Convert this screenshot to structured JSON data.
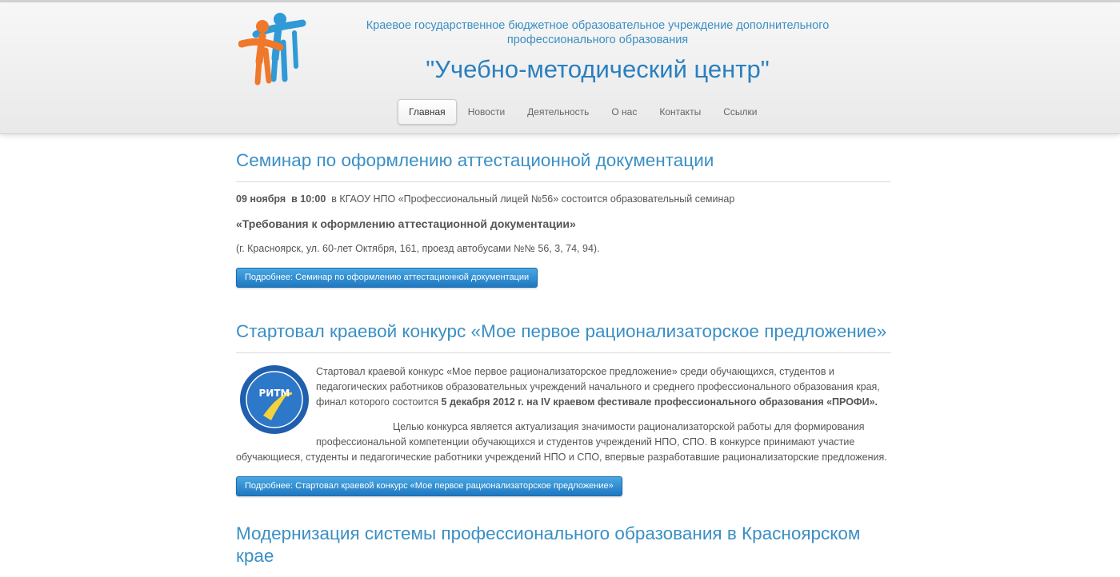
{
  "header": {
    "org_line1": "Краевое государственное бюджетное образовательное учреждение дополнительного",
    "org_line2": "профессионального образования",
    "site_title": "\"Учебно-методический центр\""
  },
  "nav": {
    "items": [
      {
        "label": "Главная",
        "active": true
      },
      {
        "label": "Новости"
      },
      {
        "label": "Деятельность"
      },
      {
        "label": "О нас"
      },
      {
        "label": "Контакты"
      },
      {
        "label": "Ссылки"
      }
    ]
  },
  "articles": [
    {
      "title": "Семинар по оформлению аттестационной документации",
      "date_bold": "09 ноября",
      "time_bold": "в 10:00",
      "intro_text": "в КГАОУ НПО «Профессиональный лицей №56»  состоится образовательный  семинар",
      "subject": "«Требования к оформлению аттестационной документации»",
      "address": "(г. Красноярск, ул. 60-лет Октября, 161, проезд  автобусами №№ 56, 3, 74, 94).",
      "more_button": "Подробнее: Семинар по оформлению аттестационной документации"
    },
    {
      "title": "Стартовал краевой конкурс «Мое первое рационализаторское предложение»",
      "logo_text": "РИТМ",
      "p1_text": "Стартовал краевой конкурс  «Мое первое рационализаторское предложение» среди обучающихся, студентов и педагогических работников образовательных учреждений начального и среднего профессионального образования края, финал которого состоится ",
      "p1_bold": "5 декабря 2012 г. на IV краевом фестивале профессионального образования «ПРОФИ».",
      "p2_text": "Целью конкурса является актуализация значимости рационализаторской работы для формирования профессиональной компетенции обучающихся и студентов учреждений НПО, СПО. В конкурсе принимают участие обучающиеся, студенты и педагогические работники учреждений НПО и СПО, впервые разработавшие рационализаторские предложения.",
      "more_button": "Подробнее: Стартовал краевой конкурс «Мое первое рационализаторское предложение»"
    },
    {
      "title": "Модернизация системы профессионального образования в Красноярском крае"
    }
  ],
  "colors": {
    "accent": "#3b8fc4",
    "button": "#2a85cc",
    "logo_orange": "#f0782a",
    "logo_blue": "#2f9ad6"
  }
}
